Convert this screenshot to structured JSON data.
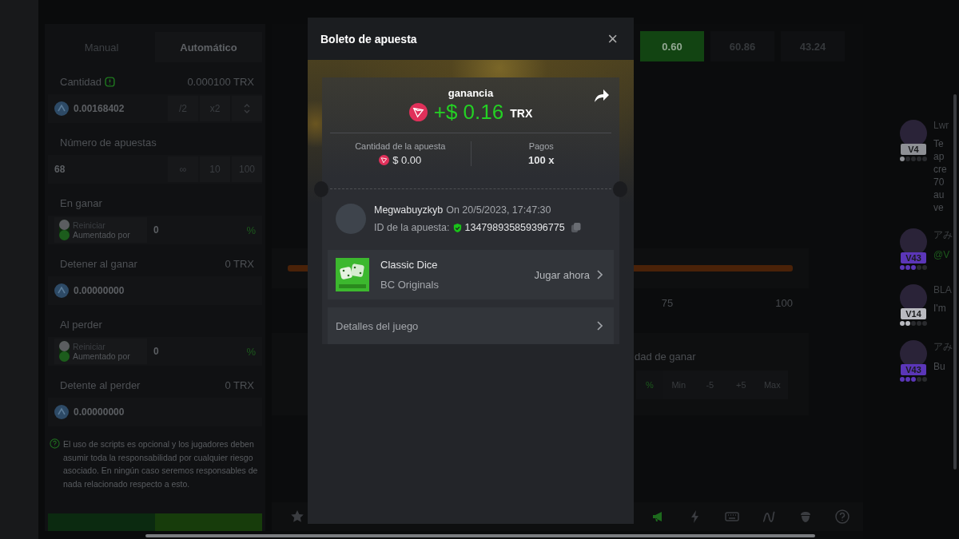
{
  "left_panel": {
    "tabs": [
      {
        "label": "Manual",
        "selected": false
      },
      {
        "label": "Automático",
        "selected": true
      }
    ],
    "amount": {
      "label": "Cantidad",
      "hint": "0.000100 TRX",
      "value": "0.00168402",
      "buttons": [
        "/2",
        "x2"
      ]
    },
    "bets_count": {
      "label": "Número de apuestas",
      "value": "68",
      "buttons": [
        "∞",
        "10",
        "100"
      ]
    },
    "sections": [
      {
        "kind": "toggle",
        "label": "En ganar",
        "options": [
          {
            "label": "Reiniciar",
            "selected": false
          },
          {
            "label": "Aumentado por",
            "selected": true
          }
        ],
        "value": "0",
        "unit": "%"
      },
      {
        "kind": "amount",
        "label": "Detener al ganar",
        "hint": "0 TRX",
        "value": "0.00000000"
      },
      {
        "kind": "toggle",
        "label": "Al perder",
        "options": [
          {
            "label": "Reiniciar",
            "selected": false
          },
          {
            "label": "Aumentado por",
            "selected": true
          }
        ],
        "value": "0",
        "unit": "%"
      },
      {
        "kind": "amount",
        "label": "Detente al perder",
        "hint": "0 TRX",
        "value": "0.00000000"
      }
    ],
    "note": "El uso de scripts es opcional y los jugadores deben asumir toda la responsabilidad por cualquier riesgo asociado. En ningún caso seremos responsables de nada relacionado respecto a esto."
  },
  "game": {
    "results": [
      {
        "label": "0.60",
        "selected": true
      },
      {
        "label": "60.86",
        "selected": false
      },
      {
        "label": "43.24",
        "selected": false
      }
    ],
    "scale": [
      "75",
      "100"
    ],
    "win_chance": {
      "label": "dad de ganar",
      "unit": "%",
      "buttons": [
        "Min",
        "-5",
        "+5",
        "Max"
      ]
    }
  },
  "modal": {
    "title": "Boleto de apuesta",
    "close": "×",
    "win_label": "ganancia",
    "win_amount": "+$ 0.16",
    "win_currency": "TRX",
    "bet_amount_label": "Cantidad de la apuesta",
    "bet_amount": "$ 0.00",
    "payout_label": "Pagos",
    "payout": "100 x",
    "user": "Megwabuyzkyb",
    "date": "On 20/5/2023, 17:47:30",
    "bet_id_label": "ID de la apuesta:",
    "bet_id": "134798935859396775",
    "game_name": "Classic Dice",
    "game_provider": "BC Originals",
    "play": "Jugar ahora",
    "details": "Detalles del juego"
  },
  "chat": {
    "messages": [
      {
        "name": "Lwr",
        "level": "V4",
        "color": "#8e9095",
        "stars": 1,
        "kind": "text",
        "lines": [
          "Te",
          "ap",
          "cre",
          "70",
          "au",
          "ve"
        ]
      },
      {
        "name": "アみ",
        "level": "V43",
        "color": "#5b36b8",
        "stars": 3,
        "kind": "mention",
        "lines": [
          "@V"
        ]
      },
      {
        "name": "BLA",
        "level": "V14",
        "color": "#b9bac0",
        "stars": 2,
        "kind": "text",
        "lines": [
          "I'm"
        ]
      },
      {
        "name": "アみ",
        "level": "V43",
        "color": "#5b36b8",
        "stars": 3,
        "kind": "text",
        "lines": [
          "Bu"
        ]
      }
    ]
  }
}
